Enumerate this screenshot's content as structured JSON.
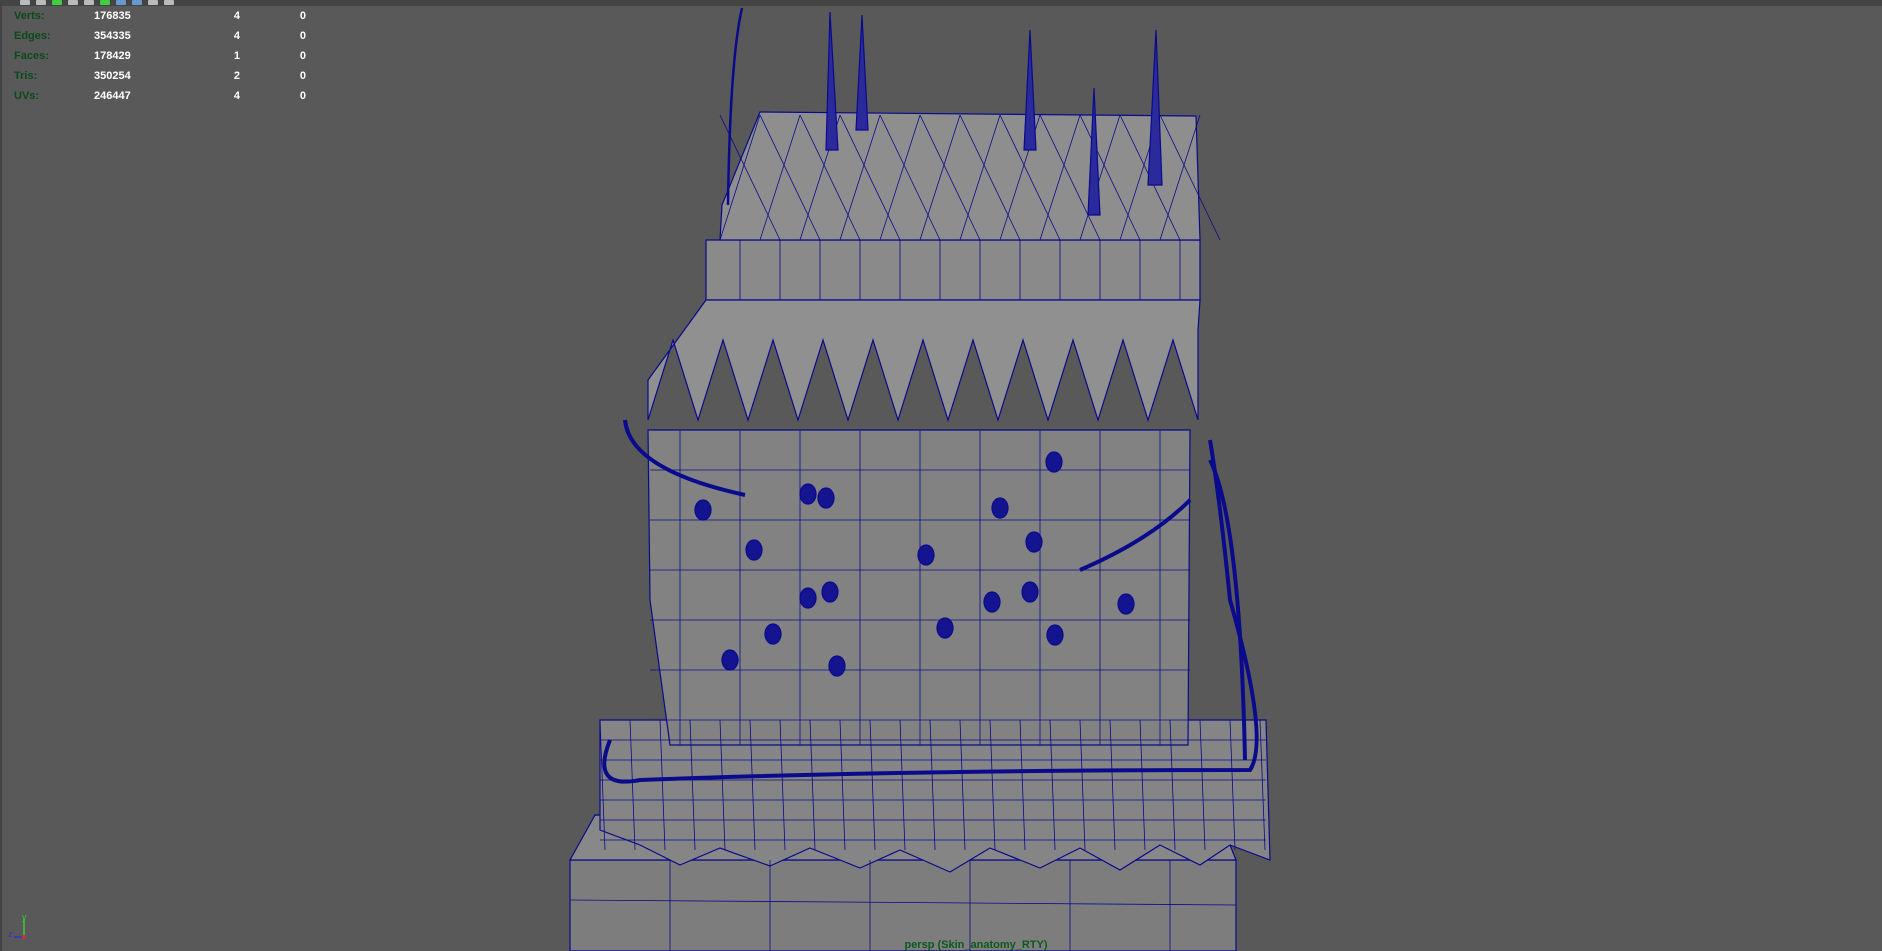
{
  "hud": {
    "rows": [
      {
        "label": "Verts:",
        "total": "176835",
        "selected": "4",
        "component": "0"
      },
      {
        "label": "Edges:",
        "total": "354335",
        "selected": "4",
        "component": "0"
      },
      {
        "label": "Faces:",
        "total": "178429",
        "selected": "1",
        "component": "0"
      },
      {
        "label": "Tris:",
        "total": "350254",
        "selected": "2",
        "component": "0"
      },
      {
        "label": "UVs:",
        "total": "246447",
        "selected": "4",
        "component": "0"
      }
    ]
  },
  "viewport": {
    "camera_label": "persp (Skin_anatomy_RTY)",
    "wire_color": "#0a0a8c",
    "bg_color": "#595959"
  },
  "axis": {
    "y": "y",
    "z": "z"
  }
}
